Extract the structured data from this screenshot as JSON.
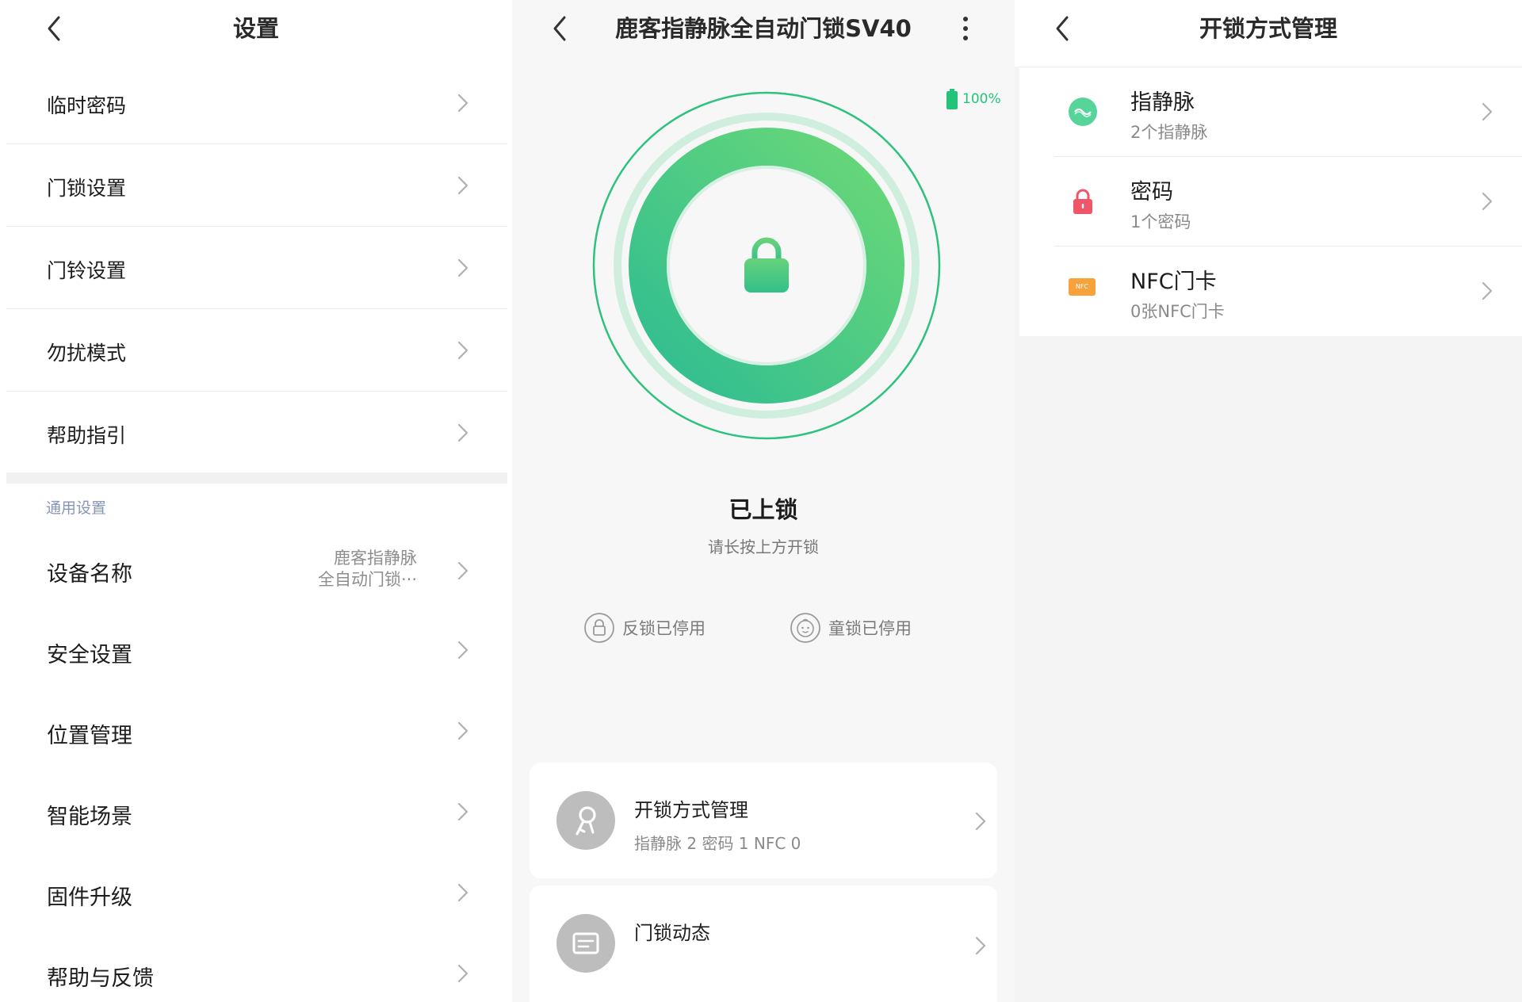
{
  "settings": {
    "title": "设置",
    "items": [
      {
        "label": "临时密码"
      },
      {
        "label": "门锁设置"
      },
      {
        "label": "门铃设置"
      },
      {
        "label": "勿扰模式"
      },
      {
        "label": "帮助指引"
      }
    ],
    "section_label": "通用设置",
    "general_items": [
      {
        "label": "设备名称",
        "value_line1": "鹿客指静脉",
        "value_line2": "全自动门锁···"
      },
      {
        "label": "安全设置"
      },
      {
        "label": "位置管理"
      },
      {
        "label": "智能场景"
      },
      {
        "label": "固件升级"
      },
      {
        "label": "帮助与反馈"
      }
    ]
  },
  "device": {
    "title": "鹿客指静脉全自动门锁SV40",
    "battery": "100%",
    "status": "已上锁",
    "hint": "请长按上方开锁",
    "deadlock": "反锁已停用",
    "childlock": "童锁已停用",
    "cards": [
      {
        "title": "开锁方式管理",
        "subtitle": "指静脉 2  密码 1  NFC 0",
        "icon": "key-icon"
      },
      {
        "title": "门锁动态",
        "subtitle": "",
        "icon": "log-icon"
      }
    ]
  },
  "unlock_methods": {
    "title": "开锁方式管理",
    "items": [
      {
        "title": "指静脉",
        "subtitle": "2个指静脉",
        "icon": "vein-icon"
      },
      {
        "title": "密码",
        "subtitle": "1个密码",
        "icon": "lock-icon"
      },
      {
        "title": "NFC门卡",
        "subtitle": "0张NFC门卡",
        "icon": "nfc-card-icon",
        "badge": "NFC"
      }
    ]
  },
  "colors": {
    "accent_green": "#2ec27e",
    "battery_green": "#23c47a",
    "ring_start": "#63d67a",
    "ring_end": "#30c08e",
    "section_label": "#8794b8"
  }
}
